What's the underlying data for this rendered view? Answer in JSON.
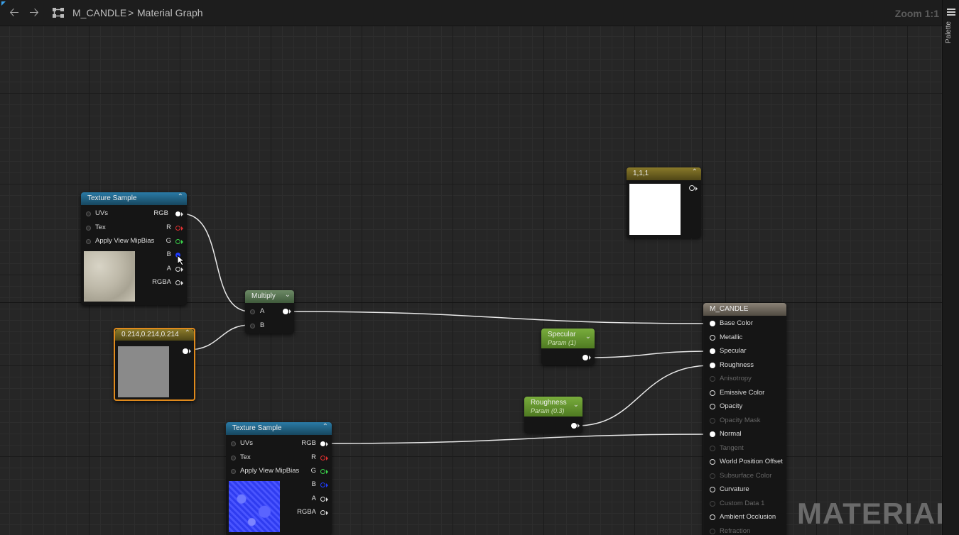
{
  "toolbar": {
    "back_glyph": "🡠",
    "forward_glyph": "🡢",
    "breadcrumb_root": "M_CANDLE",
    "breadcrumb_sep": ">",
    "breadcrumb_current": "Material Graph",
    "zoom": "Zoom 1:1"
  },
  "sidebar": {
    "palette_label": "Palette",
    "menu_icon": "hamburger-icon"
  },
  "nodes": {
    "tex1": {
      "title": "Texture Sample",
      "inputs": [
        "UVs",
        "Tex",
        "Apply View MipBias"
      ],
      "outputs": [
        "RGB",
        "R",
        "G",
        "B",
        "A",
        "RGBA"
      ],
      "preview": "gray-stone-texture"
    },
    "tex2": {
      "title": "Texture Sample",
      "inputs": [
        "UVs",
        "Tex",
        "Apply View MipBias"
      ],
      "outputs": [
        "RGB",
        "R",
        "G",
        "B",
        "A",
        "RGBA"
      ],
      "preview": "blue-normal-map"
    },
    "multiply": {
      "title": "Multiply",
      "inputs": [
        "A",
        "B"
      ]
    },
    "constant_gray": {
      "title": "0.214,0.214,0.214",
      "color": "#8a8a8a",
      "border_color": "#e08a1c"
    },
    "constant_white": {
      "title": "1,1,1",
      "color": "#ffffff"
    },
    "specular": {
      "title": "Specular",
      "subtitle": "Param (1)"
    },
    "roughness": {
      "title": "Roughness",
      "subtitle": "Param (0.3)"
    },
    "material": {
      "title": "M_CANDLE",
      "inputs": [
        {
          "label": "Base Color",
          "active": true
        },
        {
          "label": "Metallic",
          "active": true
        },
        {
          "label": "Specular",
          "active": true
        },
        {
          "label": "Roughness",
          "active": true
        },
        {
          "label": "Anisotropy",
          "active": false
        },
        {
          "label": "Emissive Color",
          "active": true
        },
        {
          "label": "Opacity",
          "active": true
        },
        {
          "label": "Opacity Mask",
          "active": false
        },
        {
          "label": "Normal",
          "active": true
        },
        {
          "label": "Tangent",
          "active": false
        },
        {
          "label": "World Position Offset",
          "active": true
        },
        {
          "label": "Subsurface Color",
          "active": false
        },
        {
          "label": "Curvature",
          "active": true
        },
        {
          "label": "Custom Data 1",
          "active": false
        },
        {
          "label": "Ambient Occlusion",
          "active": true
        },
        {
          "label": "Refraction",
          "active": false
        }
      ]
    }
  },
  "watermark": "MATERIAL",
  "colors": {
    "texture_header": "#1e5b7e",
    "multiply_header": "#55704f",
    "constant_header": "#7a6b22",
    "param_header": "#5f8f2a",
    "material_header": "#6b6358"
  }
}
